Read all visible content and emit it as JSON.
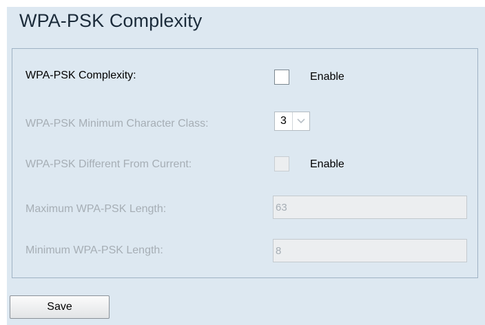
{
  "section": {
    "title": "WPA-PSK Complexity"
  },
  "rows": {
    "complexity": {
      "label": "WPA-PSK Complexity:",
      "checkbox_label": "Enable",
      "checked": false
    },
    "min_char_class": {
      "label": "WPA-PSK Minimum Character Class:",
      "selected_value": "3"
    },
    "different_from_current": {
      "label": "WPA-PSK Different From Current:",
      "checkbox_label": "Enable",
      "checked": false
    },
    "max_length": {
      "label": "Maximum WPA-PSK Length:",
      "value": "63"
    },
    "min_length": {
      "label": "Minimum WPA-PSK Length:",
      "value": "8"
    }
  },
  "actions": {
    "save_label": "Save"
  },
  "colors": {
    "panel_background": "#dde8f1",
    "disabled_text": "#a6aeb5"
  }
}
